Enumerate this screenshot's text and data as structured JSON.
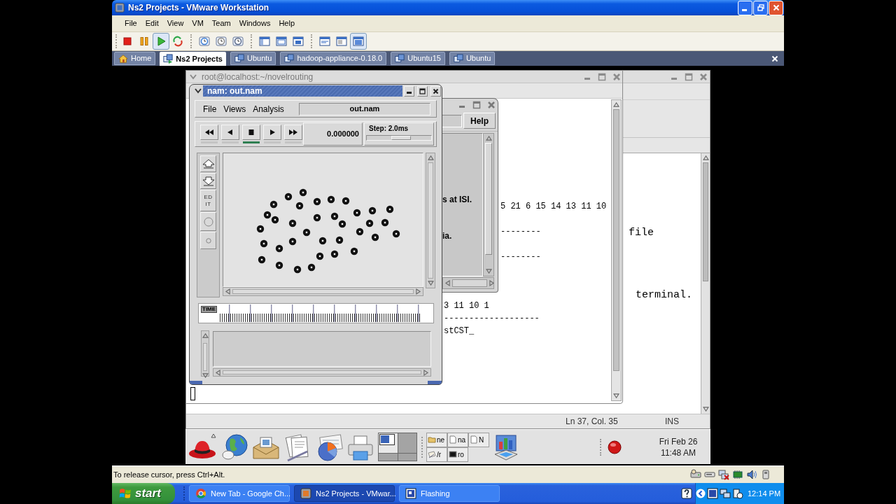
{
  "window": {
    "title": "Ns2 Projects - VMware Workstation"
  },
  "menu": [
    "File",
    "Edit",
    "View",
    "VM",
    "Team",
    "Windows",
    "Help"
  ],
  "toolbar": [
    {
      "buttons": [
        {
          "kind": "power-off",
          "pressed": false
        },
        {
          "kind": "suspend",
          "pressed": false
        },
        {
          "kind": "power-on",
          "pressed": true
        },
        {
          "kind": "reset",
          "pressed": false
        }
      ]
    },
    {
      "buttons": [
        {
          "kind": "take-snapshot",
          "pressed": false
        },
        {
          "kind": "revert-snapshot",
          "pressed": false
        },
        {
          "kind": "snapshot-manager",
          "pressed": false
        }
      ]
    },
    {
      "buttons": [
        {
          "kind": "sidebar",
          "pressed": false
        },
        {
          "kind": "full-screen",
          "pressed": false
        },
        {
          "kind": "quick-switch",
          "pressed": false
        }
      ]
    },
    {
      "buttons": [
        {
          "kind": "summary",
          "pressed": false
        },
        {
          "kind": "appliance",
          "pressed": false
        },
        {
          "kind": "console",
          "pressed": true
        }
      ]
    }
  ],
  "tabs": [
    {
      "label": "Home",
      "kind": "home",
      "selected": false
    },
    {
      "label": "Ns2 Projects",
      "kind": "team",
      "selected": true
    },
    {
      "label": "Ubuntu",
      "kind": "vm",
      "selected": false
    },
    {
      "label": "hadoop-appliance-0.18.0",
      "kind": "vm",
      "selected": false
    },
    {
      "label": "Ubuntu15",
      "kind": "vm",
      "selected": false
    },
    {
      "label": "Ubuntu",
      "kind": "vm",
      "selected": false
    }
  ],
  "guest": {
    "editor": {
      "lines": [
        "file",
        "terminal."
      ],
      "status": {
        "position": "Ln 37, Col. 35",
        "mode": "INS"
      }
    },
    "terminal": {
      "title": "root@localhost:~/novelrouting",
      "blocks": [
        {
          "lines": [
            "5 21 6 15 14 13 11 10",
            "--------",
            "--------"
          ]
        },
        {
          "lines": [
            "3 11 10 1",
            "-------------------",
            "stCST_"
          ]
        }
      ]
    },
    "console": {
      "button": "Help",
      "lines": [
        "s at ISI.",
        "ia."
      ]
    },
    "nam": {
      "title": "nam: out.nam",
      "menu": [
        "File",
        "Views",
        "Analysis"
      ],
      "file": "out.nam",
      "controls": [
        {
          "kind": "rewind",
          "selected": false
        },
        {
          "kind": "reverse",
          "selected": false
        },
        {
          "kind": "stop",
          "selected": true
        },
        {
          "kind": "play",
          "selected": false
        },
        {
          "kind": "fast-forward",
          "selected": false
        }
      ],
      "time": "0.000000",
      "step": {
        "label": "Step: 2.0ms",
        "level": 0.55
      },
      "edit_button": "EDIT",
      "timeline_label": "TIME"
    },
    "panel": {
      "workspaces": [
        {
          "selected": true
        },
        {
          "selected": false
        },
        {
          "selected": false
        },
        {
          "selected": false
        }
      ],
      "tasks": [
        {
          "label": "ne",
          "kind": "folder"
        },
        {
          "label": "na",
          "kind": "document"
        },
        {
          "label": "N",
          "kind": "document"
        },
        {
          "label": "/r",
          "kind": "notes"
        },
        {
          "label": "ro",
          "kind": "terminal"
        }
      ],
      "clock": {
        "date": "Fri Feb 26",
        "time": "11:48 AM"
      }
    }
  },
  "status_bar": {
    "message": "To release cursor, press Ctrl+Alt."
  },
  "taskbar": {
    "start": "start",
    "tasks": [
      {
        "label": "New Tab - Google Ch...",
        "kind": "browser",
        "selected": false
      },
      {
        "label": "Ns2 Projects - VMwar...",
        "kind": "vmware",
        "selected": true
      },
      {
        "label": "Flashing",
        "kind": "app",
        "selected": false
      }
    ],
    "clock": "12:14 PM"
  }
}
